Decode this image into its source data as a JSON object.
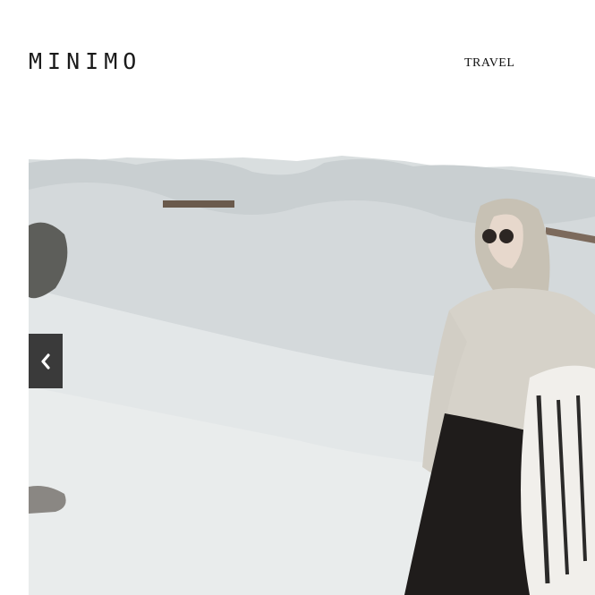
{
  "header": {
    "logo": "MINIMO",
    "nav": [
      {
        "label": "TRAVEL"
      }
    ]
  },
  "slider": {
    "prev_icon": "chevron-left-icon",
    "image_subject": "person-in-desert-photo"
  }
}
